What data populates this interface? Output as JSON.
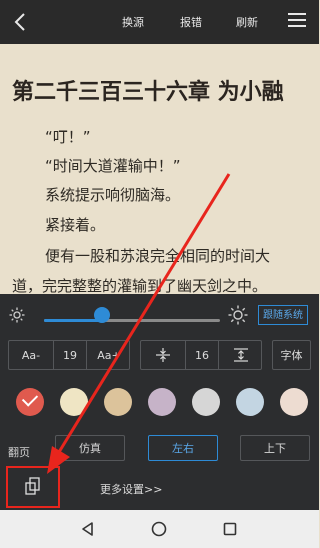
{
  "toolbar": {
    "back_icon": "chevron-left-icon",
    "actions": [
      "换源",
      "报错",
      "刷新"
    ],
    "menu_icon": "hamburger-menu-icon"
  },
  "chapter": {
    "title": "第二千三百三十六章 为小融",
    "paragraphs": [
      "“叮！”",
      "“时间大道灌输中！”",
      "系统提示响彻脑海。",
      "紧接着。",
      "便有一股和苏浪完全相同的时间大",
      "道，完完整整的灌输到了幽天剑之中。"
    ]
  },
  "settings": {
    "brightness": {
      "value": 0.33,
      "follow_system_label": "跟随系统"
    },
    "font_size": {
      "decrease_label": "Aa-",
      "value": "19",
      "increase_label": "Aa+"
    },
    "line_spacing": {
      "value": "16"
    },
    "font_label": "字体",
    "background_colors": [
      {
        "color": "#e05a4e",
        "selected": true
      },
      {
        "color": "#efe5c4",
        "selected": false
      },
      {
        "color": "#dcc39b",
        "selected": false
      },
      {
        "color": "#c6b3c8",
        "selected": false
      },
      {
        "color": "#d6d6d6",
        "selected": false
      },
      {
        "color": "#c3d5e2",
        "selected": false
      },
      {
        "color": "#eddcd1",
        "selected": false
      }
    ],
    "page_turn": {
      "label": "翻页",
      "options": [
        "仿真",
        "左右",
        "上下"
      ],
      "selected": "左右"
    },
    "orientation_icon": "screen-rotate-icon",
    "more_settings_label": "更多设置>>"
  },
  "system_nav": {
    "back_icon": "triangle-back-icon",
    "home_icon": "circle-home-icon",
    "recents_icon": "square-recents-icon"
  },
  "annotation": {
    "color": "#e8251d"
  }
}
